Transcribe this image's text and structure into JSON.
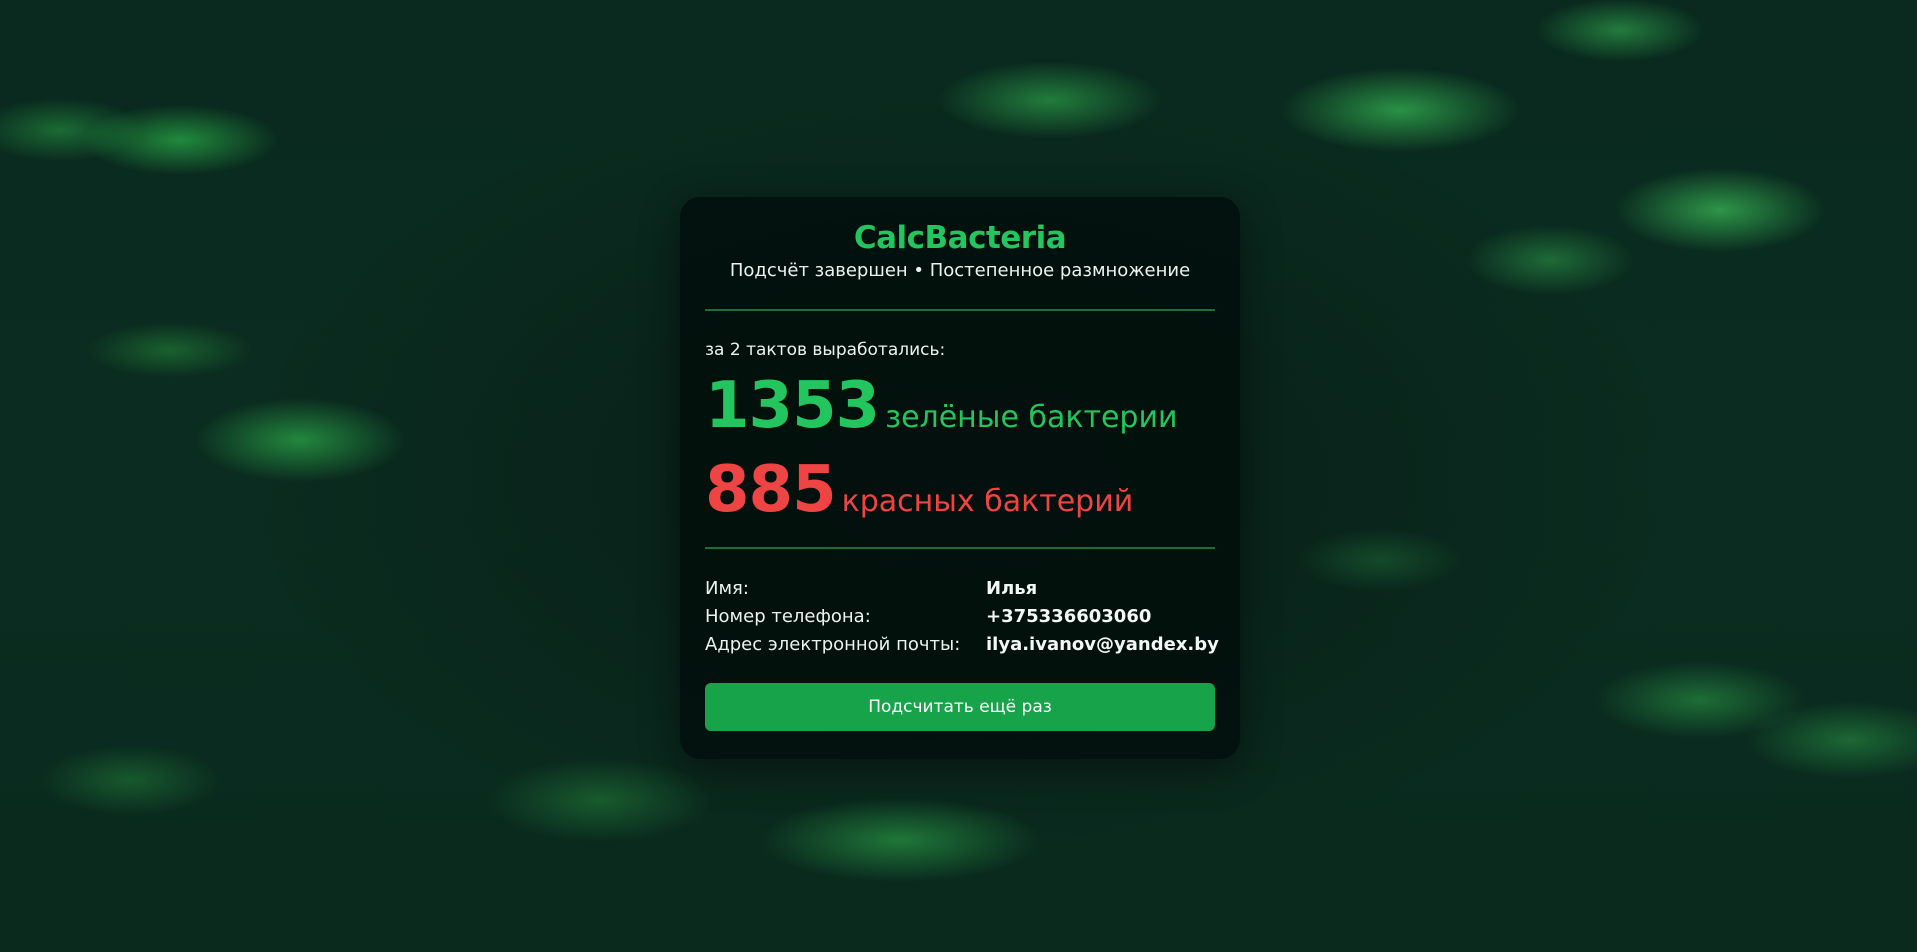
{
  "app": {
    "title": "CalcBacteria",
    "subtitle": "Подсчёт завершен • Постепенное размножение"
  },
  "result": {
    "summary": "за 2 тактов выработались:",
    "green": {
      "count": "1353",
      "label": "зелёные бактерии"
    },
    "red": {
      "count": "885",
      "label": "красных бактерий"
    }
  },
  "user": {
    "name_label": "Имя:",
    "name": "Илья",
    "phone_label": "Номер телефона:",
    "phone": "+375336603060",
    "email_label": "Адрес электронной почты:",
    "email": "ilya.ivanov@yandex.by"
  },
  "actions": {
    "recalculate_label": "Подсчитать ещё раз"
  },
  "colors": {
    "accent_green": "#22c55e",
    "accent_red": "#ef4444",
    "button_green": "#16a34a"
  }
}
